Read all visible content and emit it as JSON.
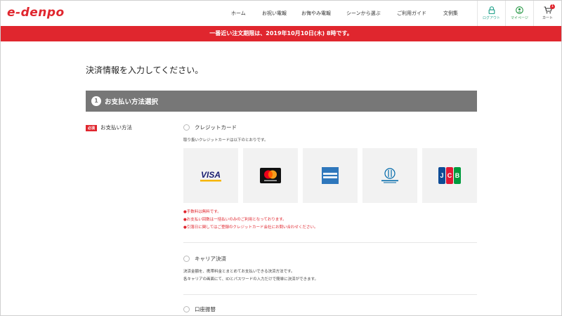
{
  "header": {
    "logo": "e-denpo",
    "nav": [
      {
        "label": "ホーム",
        "key": "home"
      },
      {
        "label": "お祝い電報",
        "key": "celebration"
      },
      {
        "label": "お悔やみ電報",
        "key": "condolence"
      },
      {
        "label": "シーンから選ぶ",
        "key": "scene"
      },
      {
        "label": "ご利用ガイド",
        "key": "guide"
      },
      {
        "label": "文例集",
        "key": "examples"
      }
    ],
    "icons": {
      "logout_label": "ログアウト",
      "mypage_label": "マイページ",
      "cart_label": "カート",
      "cart_count": "1"
    }
  },
  "banner": {
    "text": "一番近い注文期限は、2019年10月10日(木) 8時です。"
  },
  "main": {
    "page_title": "決済情報を入力してください。",
    "section": {
      "number": "1",
      "title": "お支払い方法選択"
    },
    "required_badge": "必須",
    "payment_label": "お支払い方法",
    "options": {
      "credit": {
        "label": "クレジットカード",
        "desc": "取り扱いクレジットカードは以下のとおりです。",
        "cards": [
          {
            "name": "VISA",
            "icon": "visa-logo"
          },
          {
            "name": "mastercard",
            "icon": "mastercard-logo"
          },
          {
            "name": "AMERICAN EXPRESS",
            "icon": "amex-logo"
          },
          {
            "name": "Diners Club INTERNATIONAL",
            "icon": "diners-logo"
          },
          {
            "name": "JCB",
            "icon": "jcb-logo"
          }
        ],
        "notes": [
          "●手数料は無料です。",
          "●お支払い回数は一括払いのみのご利用となっております。",
          "●引落日に関してはご登録のクレジットカード会社にお問い合わせください。"
        ]
      },
      "carrier": {
        "label": "キャリア決済",
        "desc1": "決済金額を、携帯料金とまとめてお支払いできる決済方法です。",
        "desc2": "各キャリアの画面にて、IDとパスワードの入力だけで簡単に決済ができます。"
      },
      "bank": {
        "label": "口座振替"
      }
    }
  },
  "colors": {
    "brand_red": "#e0262e",
    "section_gray": "#777777",
    "logout_teal": "#29a58f",
    "mypage_green": "#2c9a4a"
  }
}
